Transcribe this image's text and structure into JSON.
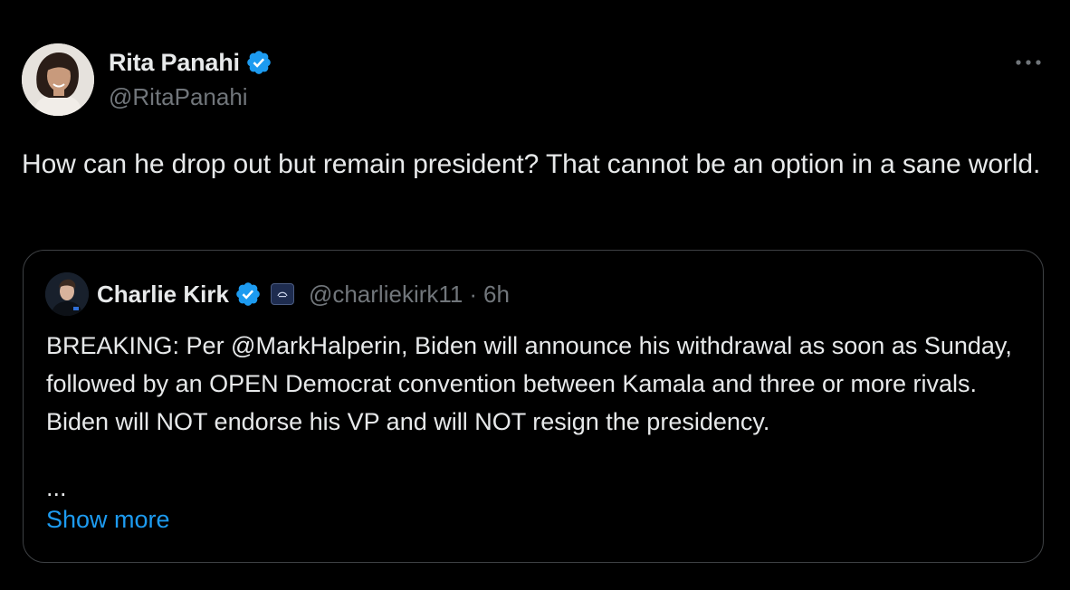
{
  "tweet": {
    "author": {
      "name": "Rita Panahi",
      "handle": "@RitaPanahi",
      "verified": true,
      "avatar": "author-avatar-photo"
    },
    "more_icon": "more-horizontal-icon",
    "text": "How can he drop out but remain president? That cannot be an option in a sane world."
  },
  "quoted_tweet": {
    "author": {
      "name": "Charlie Kirk",
      "handle": "@charliekirk11",
      "verified": true,
      "affiliate_badge": "affiliate-badge-icon",
      "avatar": "quoted-author-avatar-photo"
    },
    "separator": "·",
    "time": "6h",
    "text": "BREAKING: Per @MarkHalperin, Biden will announce his withdrawal as soon as Sunday, followed by an OPEN Democrat convention between Kamala and three or more rivals. Biden will NOT endorse his VP and will NOT resign the presidency.",
    "ellipsis": "...",
    "show_more": "Show more"
  },
  "colors": {
    "background": "#000000",
    "text_primary": "#e7e9ea",
    "text_secondary": "#71767b",
    "link": "#1d9bf0",
    "verified": "#1d9bf0",
    "border": "#3e4144"
  }
}
